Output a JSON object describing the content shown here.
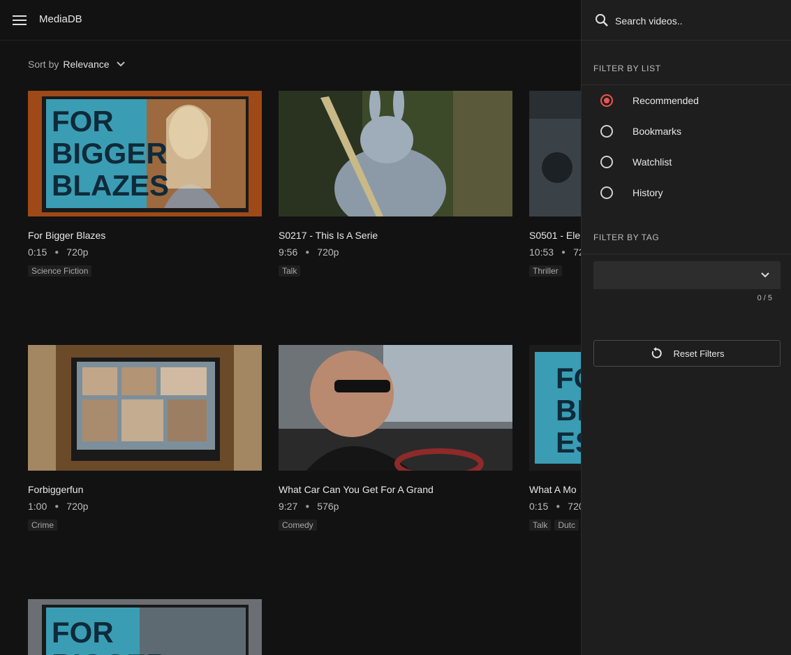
{
  "app": {
    "title": "MediaDB"
  },
  "sort": {
    "label": "Sort by",
    "value": "Relevance"
  },
  "videos": [
    {
      "title": "For Bigger Blazes",
      "duration": "0:15",
      "quality": "720p",
      "tags": [
        "Science Fiction"
      ],
      "thumb_text": "FOR BIGGER BLAZES"
    },
    {
      "title": "S0217 - This Is A Serie",
      "duration": "9:56",
      "quality": "720p",
      "tags": [
        "Talk"
      ]
    },
    {
      "title": "S0501 - Ele",
      "duration": "10:53",
      "quality": "72",
      "tags": [
        "Thriller"
      ]
    },
    {
      "title": "Forbiggerfun",
      "duration": "1:00",
      "quality": "720p",
      "tags": [
        "Crime"
      ]
    },
    {
      "title": "What Car Can You Get For A Grand",
      "duration": "9:27",
      "quality": "576p",
      "tags": [
        "Comedy"
      ]
    },
    {
      "title": "What A Mo",
      "duration": "0:15",
      "quality": "720",
      "tags": [
        "Talk",
        "Dutc"
      ],
      "thumb_text": "FO BI ES"
    },
    {
      "title": "",
      "duration": "",
      "quality": "",
      "tags": [],
      "thumb_text": "FOR BIGGER"
    }
  ],
  "drawer": {
    "search_placeholder": "Search videos..",
    "filter_by_list": "FILTER BY LIST",
    "lists": [
      {
        "label": "Recommended",
        "checked": true
      },
      {
        "label": "Bookmarks",
        "checked": false
      },
      {
        "label": "Watchlist",
        "checked": false
      },
      {
        "label": "History",
        "checked": false
      }
    ],
    "filter_by_tag": "FILTER BY TAG",
    "tag_counter": "0 / 5",
    "reset_label": "Reset Filters"
  },
  "colors": {
    "accent": "#ef5350",
    "background": "#121212",
    "drawer": "#1e1e1e"
  }
}
